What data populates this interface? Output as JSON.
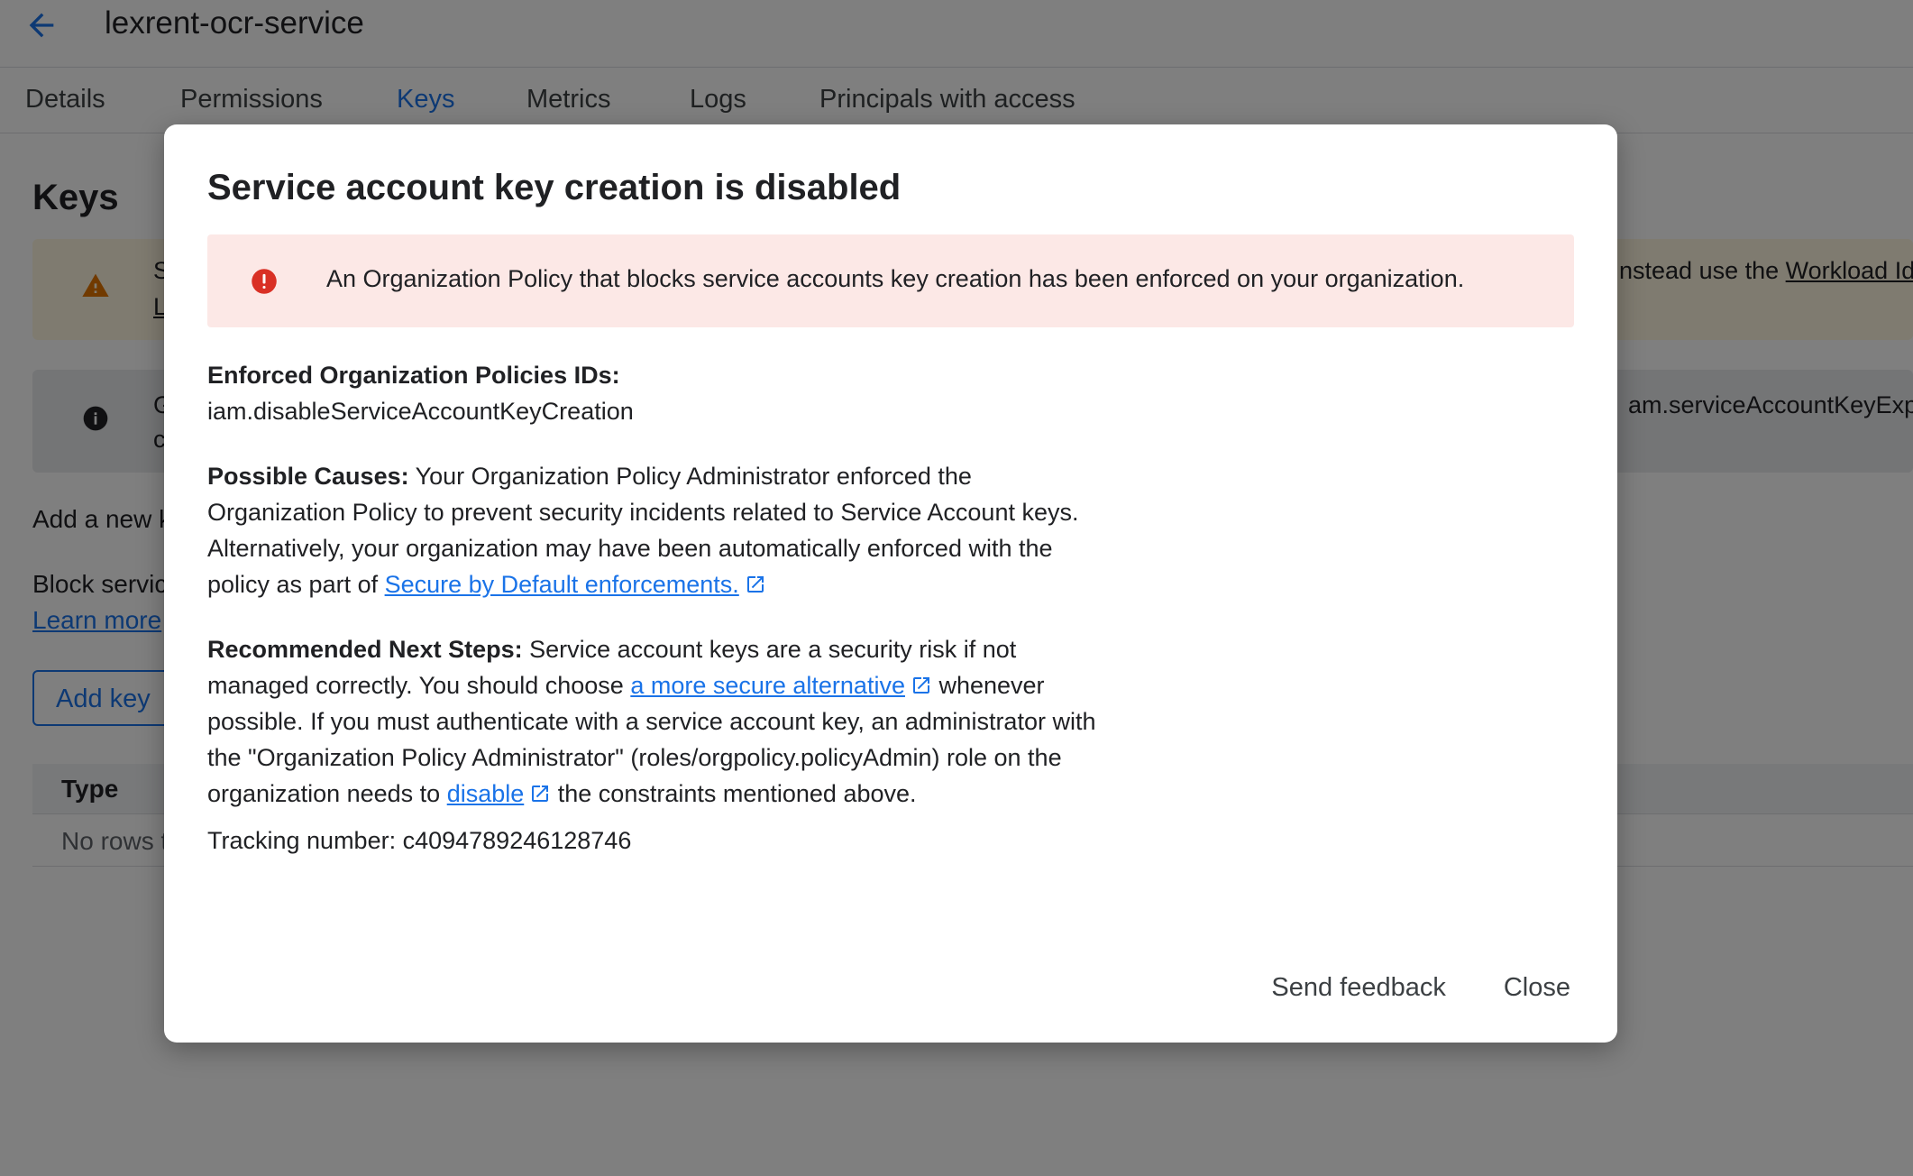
{
  "header": {
    "title": "lexrent-ocr-service",
    "back_icon": "arrow-back-icon"
  },
  "tabs": [
    {
      "label": "Details"
    },
    {
      "label": "Permissions"
    },
    {
      "label": "Keys",
      "active": true
    },
    {
      "label": "Metrics"
    },
    {
      "label": "Logs"
    },
    {
      "label": "Principals with access"
    }
  ],
  "page": {
    "heading": "Keys",
    "warning_banner": {
      "text_left": "S",
      "text_right": "nstead use the ",
      "link": "Workload Id",
      "line2": "L"
    },
    "info_banner": {
      "text_left": "G",
      "text_right": "am.serviceAccountKeyExp",
      "line2": "c"
    },
    "add_new_text": "Add a new k",
    "block_text": "Block servic",
    "learn_more": "Learn more",
    "add_key_button": "Add key",
    "table": {
      "column_type": "Type",
      "empty_text": "No rows t"
    }
  },
  "dialog": {
    "title": "Service account key creation is disabled",
    "error_message": "An Organization Policy that blocks service accounts key creation has been enforced on your organization.",
    "policies_label": "Enforced Organization Policies IDs:",
    "policies_value": "iam.disableServiceAccountKeyCreation",
    "causes_label": "Possible Causes:",
    "causes_text": " Your Organization Policy Administrator enforced the Organization Policy to prevent security incidents related to Service Account keys. Alternatively, your organization may have been automatically enforced with the policy as part of ",
    "causes_link": "Secure by Default enforcements.",
    "steps_label": "Recommended Next Steps:",
    "steps_text_1": " Service account keys are a security risk if not managed correctly. You should choose ",
    "steps_link_1": "a more secure alternative",
    "steps_text_2": " whenever possible. If you must authenticate with a service account key, an administrator with the \"Organization Policy Administrator\" (roles/orgpolicy.policyAdmin) role on the organization needs to ",
    "steps_link_2": "disable",
    "steps_text_3": " the constraints mentioned above.",
    "tracking": "Tracking number: c4094789246128746",
    "send_feedback": "Send feedback",
    "close": "Close"
  },
  "colors": {
    "accent": "#1a73e8",
    "error_bg": "#fce8e6",
    "error_icon": "#d93025",
    "warning_icon": "#e37400"
  }
}
